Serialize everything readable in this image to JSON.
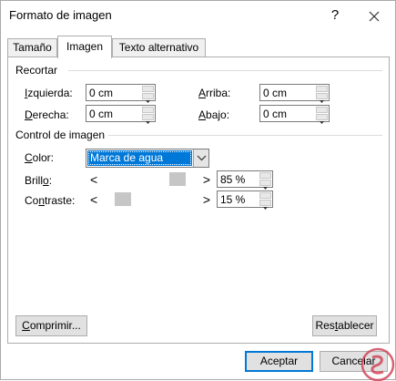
{
  "window": {
    "title": "Formato de imagen",
    "help_label": "?",
    "icons": {
      "help": "help-icon",
      "close": "close-icon"
    }
  },
  "tabs": [
    {
      "label": "Tamaño",
      "active": false
    },
    {
      "label": "Imagen",
      "active": true
    },
    {
      "label": "Texto alternativo",
      "active": false
    }
  ],
  "crop": {
    "heading": "Recortar",
    "left": {
      "label_key": "I",
      "label_rest": "zquierda:",
      "value": "0 cm"
    },
    "right": {
      "label_key": "D",
      "label_rest": "erecha:",
      "value": "0 cm"
    },
    "top": {
      "label_key": "A",
      "label_rest": "rriba:",
      "value": "0 cm"
    },
    "bottom": {
      "label_key": "A",
      "label_rest": "bajo:",
      "value": "0 cm"
    }
  },
  "image_control": {
    "heading": "Control de imagen",
    "color": {
      "label_key": "C",
      "label_rest": "olor:",
      "selected": "Marca de agua"
    },
    "brightness": {
      "label_pre": "Brill",
      "label_key": "o",
      "label_post": ":",
      "value": "85 %",
      "level": 0.85
    },
    "contrast": {
      "label_pre": "Co",
      "label_key": "n",
      "label_post": "traste:",
      "value": "15 %",
      "level": 0.15
    },
    "decrease_glyph": "<",
    "increase_glyph": ">"
  },
  "buttons": {
    "compress_key": "C",
    "compress_rest": "omprimir...",
    "reset_pre": "Res",
    "reset_key": "t",
    "reset_post": "ablecer",
    "ok": "Aceptar",
    "cancel": "Cancelar"
  },
  "colors": {
    "accent": "#0078d7",
    "selection_text": "#ffffff",
    "watermark": "#d0465a"
  }
}
